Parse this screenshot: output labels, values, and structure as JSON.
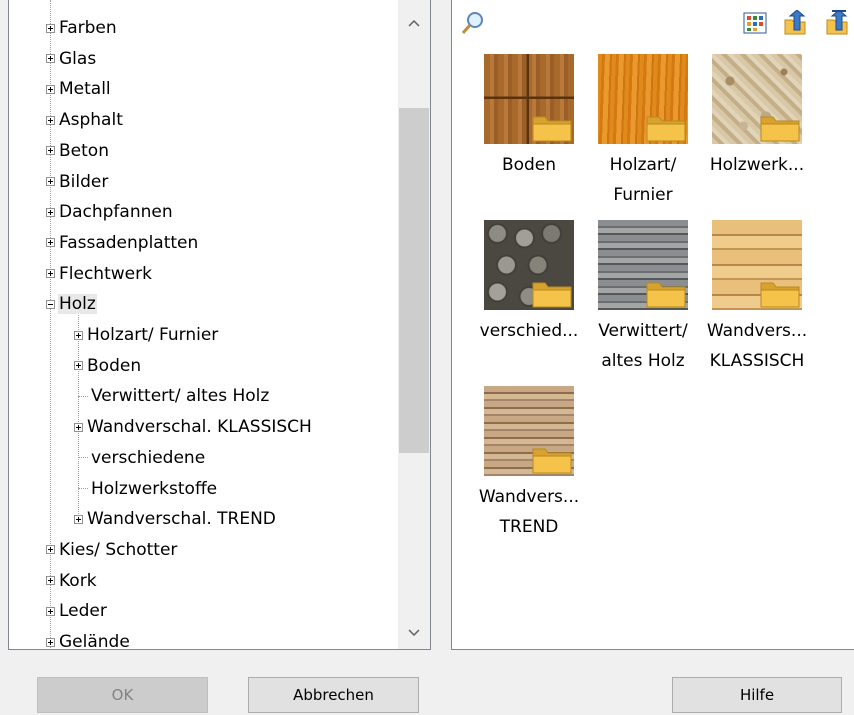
{
  "tree": {
    "items": [
      {
        "label": "Farben",
        "level": 0,
        "state": "collapsed"
      },
      {
        "label": "Glas",
        "level": 0,
        "state": "collapsed"
      },
      {
        "label": "Metall",
        "level": 0,
        "state": "collapsed"
      },
      {
        "label": "Asphalt",
        "level": 0,
        "state": "collapsed"
      },
      {
        "label": "Beton",
        "level": 0,
        "state": "collapsed"
      },
      {
        "label": "Bilder",
        "level": 0,
        "state": "collapsed"
      },
      {
        "label": "Dachpfannen",
        "level": 0,
        "state": "collapsed"
      },
      {
        "label": "Fassadenplatten",
        "level": 0,
        "state": "collapsed"
      },
      {
        "label": "Flechtwerk",
        "level": 0,
        "state": "collapsed"
      },
      {
        "label": "Holz",
        "level": 0,
        "state": "expanded",
        "selected": true
      },
      {
        "label": "Holzart/ Furnier",
        "level": 1,
        "state": "collapsed"
      },
      {
        "label": "Boden",
        "level": 1,
        "state": "collapsed"
      },
      {
        "label": "Verwittert/ altes Holz",
        "level": 1,
        "state": "leaf"
      },
      {
        "label": "Wandverschal. KLASSISCH",
        "level": 1,
        "state": "collapsed"
      },
      {
        "label": "verschiedene",
        "level": 1,
        "state": "leaf"
      },
      {
        "label": "Holzwerkstoffe",
        "level": 1,
        "state": "leaf"
      },
      {
        "label": "Wandverschal. TREND",
        "level": 1,
        "state": "collapsed"
      },
      {
        "label": "Kies/ Schotter",
        "level": 0,
        "state": "collapsed"
      },
      {
        "label": "Kork",
        "level": 0,
        "state": "collapsed"
      },
      {
        "label": "Leder",
        "level": 0,
        "state": "collapsed"
      },
      {
        "label": "Gelände",
        "level": 0,
        "state": "collapsed"
      }
    ],
    "scroll_up_icon": "chevron-up-icon",
    "scroll_down_icon": "chevron-down-icon"
  },
  "toolbar": {
    "search_icon": "magnifier-icon",
    "view_icon": "grid-view-icon",
    "up_icon": "folder-up-icon",
    "root_icon": "folder-root-icon"
  },
  "tiles": [
    {
      "label": "Boden",
      "texture": "boden"
    },
    {
      "label": "Holzart/\nFurnier",
      "texture": "holzart"
    },
    {
      "label": "Holzwerk...",
      "texture": "werk"
    },
    {
      "label": "verschied...",
      "texture": "versch"
    },
    {
      "label": "Verwittert/\naltes Holz",
      "texture": "verwittert"
    },
    {
      "label": "Wandvers...\nKLASSISCH",
      "texture": "klassisch"
    },
    {
      "label": "Wandvers...\nTREND",
      "texture": "trend"
    }
  ],
  "buttons": {
    "ok": "OK",
    "cancel": "Abbrechen",
    "help": "Hilfe"
  },
  "colors": {
    "folder": "#f5c24a",
    "folder_dark": "#d9a12e"
  }
}
